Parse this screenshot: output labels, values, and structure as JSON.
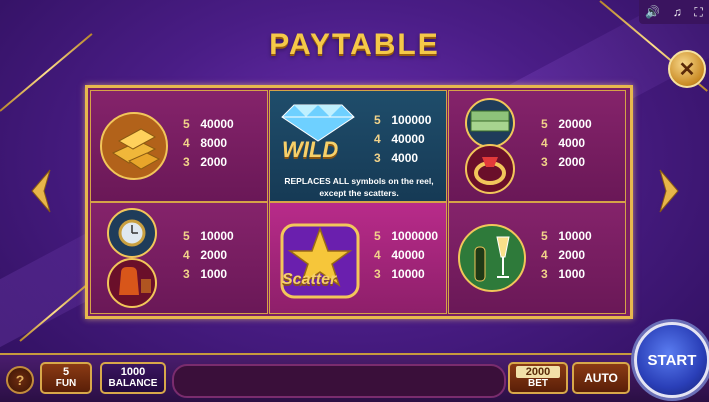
{
  "header": {
    "title": "PAYTABLE"
  },
  "top_icons": [
    "speaker-icon",
    "music-icon",
    "fullscreen-icon"
  ],
  "symbols": [
    {
      "id": "gold",
      "pays": [
        {
          "count": "5",
          "value": "40000"
        },
        {
          "count": "4",
          "value": "8000"
        },
        {
          "count": "3",
          "value": "2000"
        }
      ]
    },
    {
      "id": "wild",
      "label": "WILD",
      "description_line1": "REPLACES ALL symbols on the reel,",
      "description_line2": "except the scatters.",
      "pays": [
        {
          "count": "5",
          "value": "100000"
        },
        {
          "count": "4",
          "value": "40000"
        },
        {
          "count": "3",
          "value": "4000"
        }
      ]
    },
    {
      "id": "money-ring",
      "pays": [
        {
          "count": "5",
          "value": "20000"
        },
        {
          "count": "4",
          "value": "4000"
        },
        {
          "count": "3",
          "value": "2000"
        }
      ]
    },
    {
      "id": "watch-cognac",
      "pays": [
        {
          "count": "5",
          "value": "10000"
        },
        {
          "count": "4",
          "value": "2000"
        },
        {
          "count": "3",
          "value": "1000"
        }
      ]
    },
    {
      "id": "scatter",
      "label": "Scatter",
      "pays": [
        {
          "count": "5",
          "value": "1000000"
        },
        {
          "count": "4",
          "value": "40000"
        },
        {
          "count": "3",
          "value": "10000"
        }
      ]
    },
    {
      "id": "champagne",
      "pays": [
        {
          "count": "5",
          "value": "10000"
        },
        {
          "count": "4",
          "value": "2000"
        },
        {
          "count": "3",
          "value": "1000"
        }
      ]
    }
  ],
  "bottom": {
    "help": "?",
    "fun_value": "5",
    "fun_label": "FUN",
    "balance_value": "1000",
    "balance_label": "BALANCE",
    "bet_value": "2000",
    "bet_label": "BET",
    "auto_label": "AUTO",
    "start_label": "START"
  },
  "colors": {
    "gold": "#f5c949",
    "panel": "#7b1f63",
    "wild_cell": "#1f4d6b",
    "scatter_cell": "#b82b8a",
    "start": "#2a3fb8"
  }
}
